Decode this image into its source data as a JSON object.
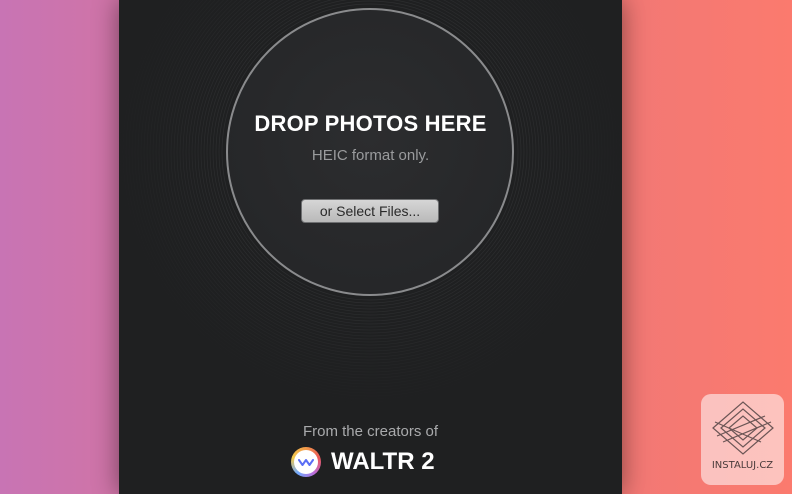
{
  "dropzone": {
    "title": "DROP PHOTOS HERE",
    "subtitle": "HEIC format only.",
    "select_button": "or Select Files..."
  },
  "footer": {
    "creators_text": "From the creators of",
    "product_name": "WALTR 2",
    "logo_icon": "waltr-logo-icon"
  },
  "watermark": {
    "text": "INSTALUJ.CZ"
  },
  "colors": {
    "window_bg": "#1f2021",
    "background_left": "#c874b4",
    "background_right": "#fb7a6e"
  }
}
